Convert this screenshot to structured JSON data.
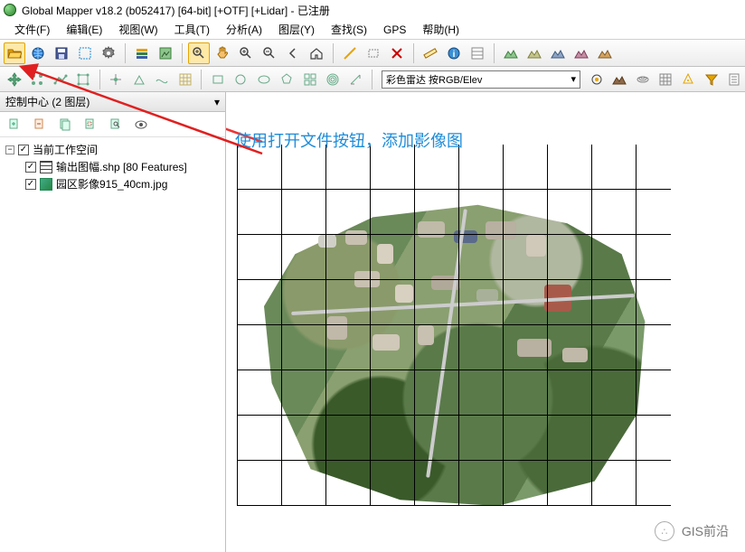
{
  "titlebar": {
    "text": "Global Mapper v18.2 (b052417) [64-bit] [+OTF] [+Lidar] - 已注册"
  },
  "menu": {
    "file": "文件(F)",
    "edit": "编辑(E)",
    "view": "视图(W)",
    "tools": "工具(T)",
    "analyze": "分析(A)",
    "layer": "图层(Y)",
    "search": "查找(S)",
    "gps": "GPS",
    "help": "帮助(H)"
  },
  "combo": {
    "shader": "彩色雷达 按RGB/Elev"
  },
  "panel": {
    "title": "控制中心 (2 图层)",
    "root": "当前工作空间",
    "layer1": "输出图幅.shp [80 Features]",
    "layer2": "园区影像915_40cm.jpg"
  },
  "annotation": {
    "text": "使用打开文件按钮，添加影像图"
  },
  "watermark": {
    "text": "GIS前沿"
  }
}
